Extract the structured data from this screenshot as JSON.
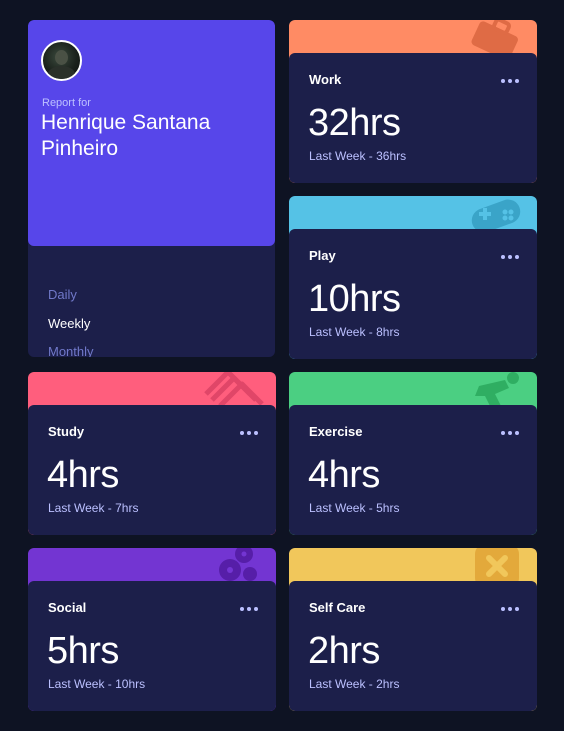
{
  "colors": {
    "background": "#0e1323",
    "card": "#1c1f4a",
    "profile_accent": "#5746ea",
    "work": "#ff8b64",
    "play": "#55c2e6",
    "study": "#ff5e7d",
    "exercise": "#4bcf82",
    "social": "#7335d2",
    "self_care": "#f1c75b"
  },
  "profile": {
    "avatar_icon": "user-avatar",
    "report_for": "Report for",
    "name": "Henrique Santana Pinheiro",
    "periods": [
      "Daily",
      "Weekly",
      "Monthly"
    ],
    "selected_period": "Weekly"
  },
  "activities": [
    {
      "title": "Work",
      "current": "32hrs",
      "previous": "Last Week - 36hrs",
      "icon": "briefcase-icon",
      "color": "#ff8b64"
    },
    {
      "title": "Play",
      "current": "10hrs",
      "previous": "Last Week - 8hrs",
      "icon": "gamepad-icon",
      "color": "#55c2e6"
    },
    {
      "title": "Study",
      "current": "4hrs",
      "previous": "Last Week - 7hrs",
      "icon": "book-icon",
      "color": "#ff5e7d"
    },
    {
      "title": "Exercise",
      "current": "4hrs",
      "previous": "Last Week - 5hrs",
      "icon": "running-icon",
      "color": "#4bcf82"
    },
    {
      "title": "Social",
      "current": "5hrs",
      "previous": "Last Week - 10hrs",
      "icon": "social-icon",
      "color": "#7335d2"
    },
    {
      "title": "Self Care",
      "current": "2hrs",
      "previous": "Last Week - 2hrs",
      "icon": "self-care-icon",
      "color": "#f1c75b"
    }
  ]
}
